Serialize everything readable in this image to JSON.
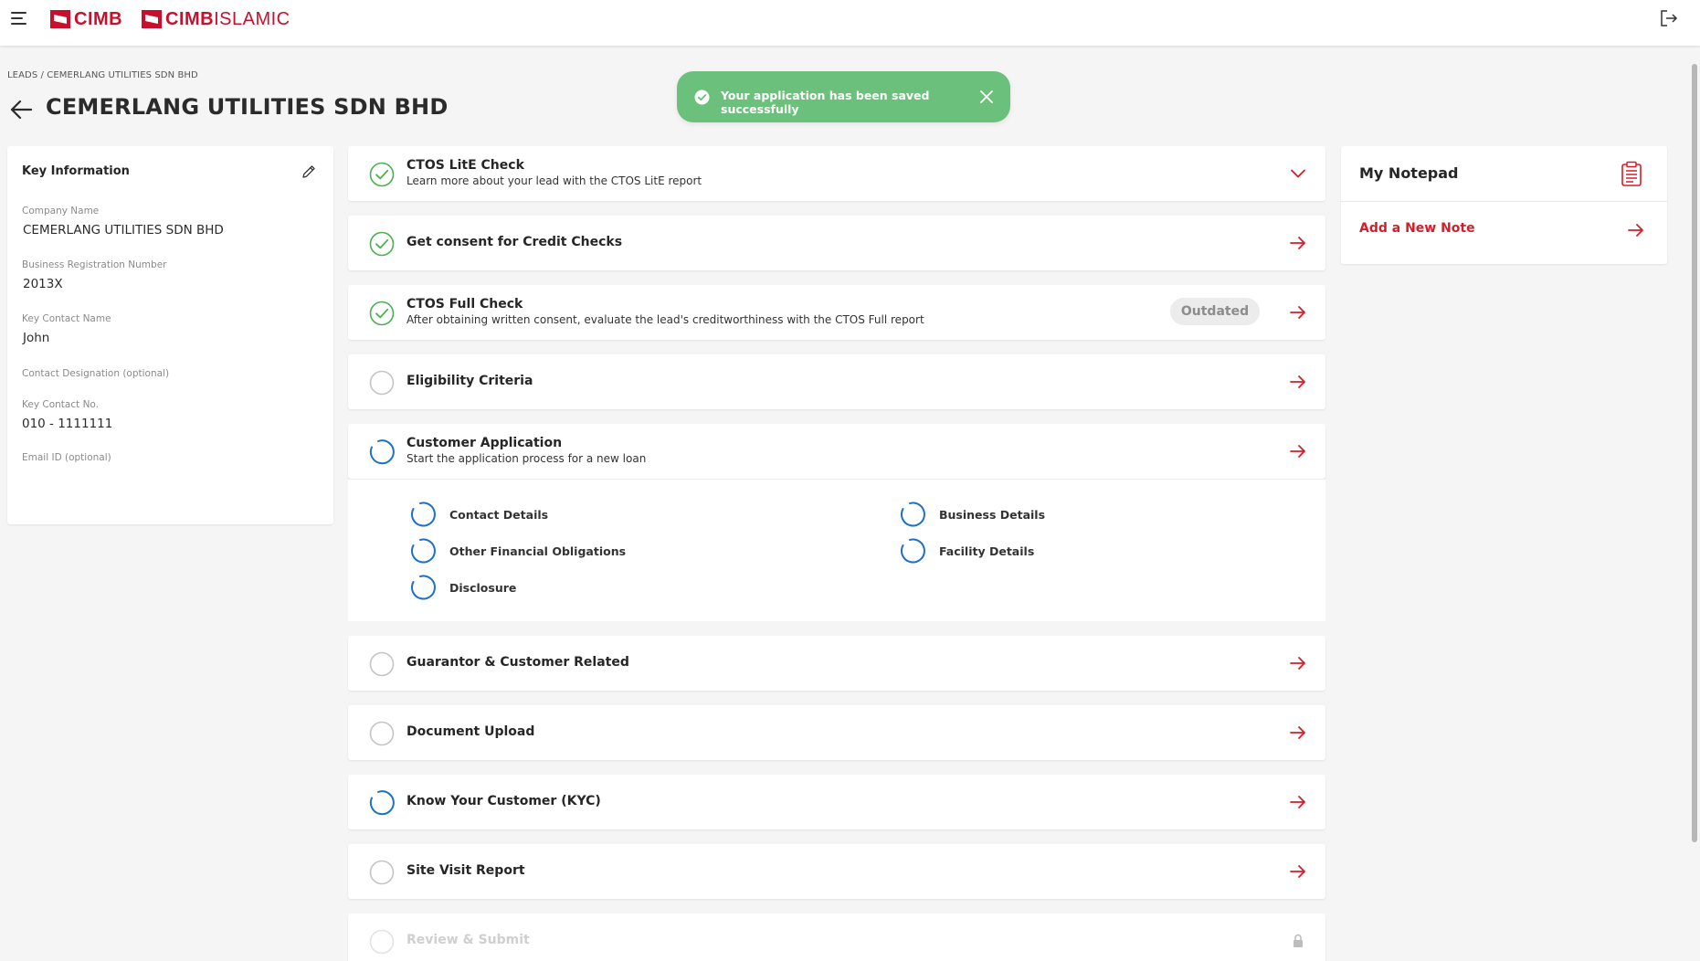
{
  "header": {
    "brand_primary": "CIMB",
    "brand_secondary_bold": "CIMB",
    "brand_secondary_light": "ISLAMIC"
  },
  "breadcrumb": "LEADS / CEMERLANG UTILITIES SDN BHD",
  "page_title": "CEMERLANG UTILITIES SDN BHD",
  "toast": {
    "message": "Your application has been saved successfully"
  },
  "key_info": {
    "title": "Key Information",
    "fields": [
      {
        "label": "Company Name",
        "value": "CEMERLANG UTILITIES SDN BHD"
      },
      {
        "label": "Business Registration Number",
        "value": "2013X"
      },
      {
        "label": "Key Contact Name",
        "value": "John"
      },
      {
        "label": "Contact Designation (optional)",
        "value": ""
      },
      {
        "label": "Key Contact No.",
        "value": "010 - 1111111"
      },
      {
        "label": "Email ID (optional)",
        "value": ""
      }
    ]
  },
  "steps": [
    {
      "title": "CTOS LitE Check",
      "subtitle": "Learn more about your lead with the CTOS LitE report",
      "status": "done",
      "action": "chevron-down"
    },
    {
      "title": "Get consent for Credit Checks",
      "subtitle": "",
      "status": "done",
      "action": "arrow"
    },
    {
      "title": "CTOS Full Check",
      "subtitle": "After obtaining written consent, evaluate the lead's creditworthiness with the CTOS Full report",
      "status": "done",
      "badge": "Outdated",
      "action": "arrow"
    },
    {
      "title": "Eligibility Criteria",
      "subtitle": "",
      "status": "empty",
      "action": "arrow"
    },
    {
      "title": "Customer Application",
      "subtitle": "Start the application process for a new loan",
      "status": "progress",
      "action": "arrow"
    },
    {
      "title": "Guarantor & Customer Related",
      "subtitle": "",
      "status": "empty",
      "action": "arrow"
    },
    {
      "title": "Document Upload",
      "subtitle": "",
      "status": "empty",
      "action": "arrow"
    },
    {
      "title": "Know Your Customer (KYC)",
      "subtitle": "",
      "status": "progress",
      "action": "arrow"
    },
    {
      "title": "Site Visit Report",
      "subtitle": "",
      "status": "empty",
      "action": "arrow"
    },
    {
      "title": "Review & Submit",
      "subtitle": "",
      "status": "disabled",
      "action": "lock"
    }
  ],
  "customer_application_subitems": [
    {
      "label": "Contact Details",
      "status": "progress"
    },
    {
      "label": "Business Details",
      "status": "progress"
    },
    {
      "label": "Other Financial Obligations",
      "status": "progress"
    },
    {
      "label": "Facility Details",
      "status": "progress"
    },
    {
      "label": "Disclosure",
      "status": "progress"
    }
  ],
  "notepad": {
    "title": "My Notepad",
    "add_label": "Add a New Note"
  },
  "colors": {
    "brand_red": "#c8102e",
    "action_red": "#d31e2a",
    "success_green": "#6bc07b",
    "check_green": "#4caf50",
    "progress_blue": "#1f6fc5",
    "empty_grey": "#c4c4c4"
  }
}
